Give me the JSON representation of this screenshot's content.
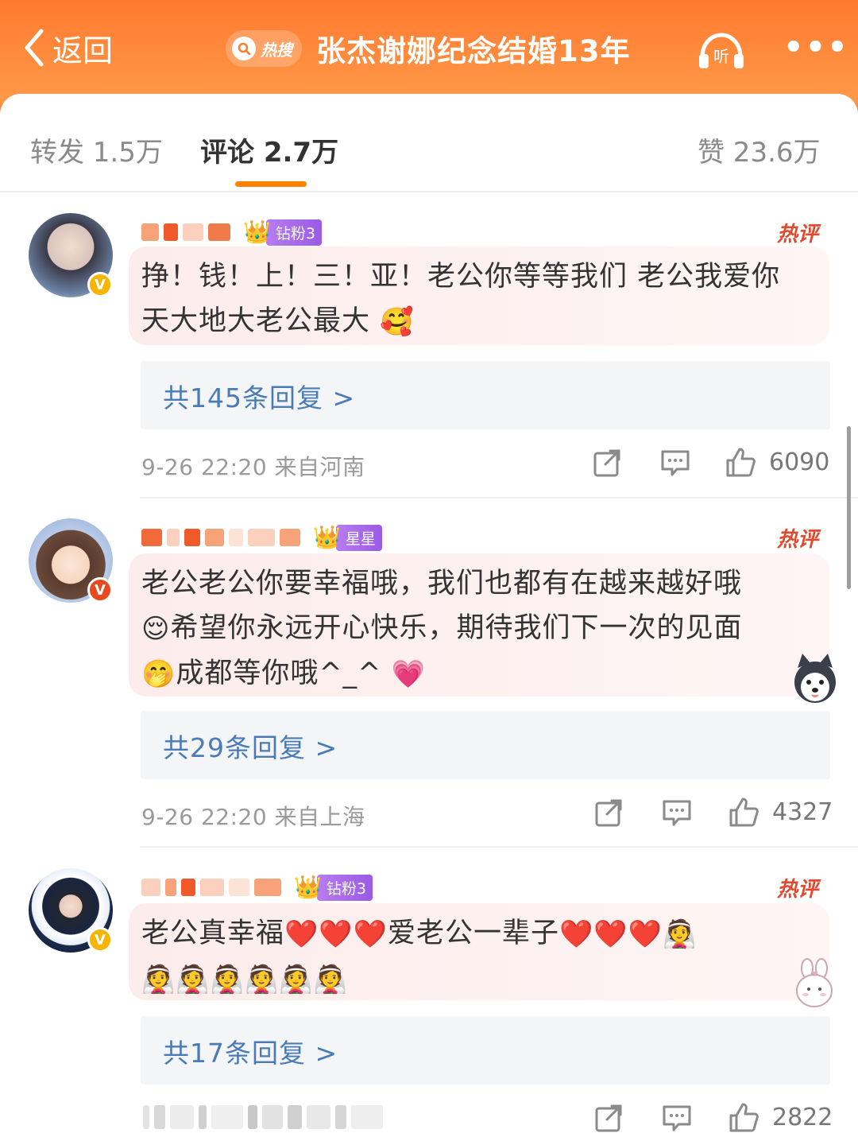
{
  "header": {
    "back_label": "返回",
    "hot_tag": "热搜",
    "title": "张杰谢娜纪念结婚13年",
    "listen_label": "听"
  },
  "tabs": {
    "repost": "转发 1.5万",
    "comment": "评论 2.7万",
    "like": "赞 23.6万"
  },
  "comments": [
    {
      "badge_label": "钻粉3",
      "hot_label": "热评",
      "text": "挣！钱！上！三！亚！老公你等等我们 老公我爱你 天大地大老公最大",
      "text_emoji": "🥰",
      "replies": "共145条回复 >",
      "meta": "9-26 22:20  来自河南",
      "likes": "6090",
      "verified": "V"
    },
    {
      "badge_label": "星星",
      "hot_label": "热评",
      "text_part1": "老公老公你要幸福哦，我们也都有在越来越好哦",
      "text_part2": "希望你永远开心快乐，期待我们下一次的见面",
      "text_part3": "成都等你哦^_^",
      "replies": "共29条回复 >",
      "meta": "9-26 22:20  来自上海",
      "likes": "4327",
      "verified": "V"
    },
    {
      "badge_label": "钻粉3",
      "hot_label": "热评",
      "text_part1": "老公真幸福",
      "text_part2": "爱老公一辈子",
      "replies": "共17条回复 >",
      "likes": "2822",
      "verified": "V"
    }
  ],
  "colors": {
    "header_orange": "#ff8a3d",
    "accent": "#ff8200",
    "link_blue": "#4a7bb5",
    "hot_red": "#e24a2f"
  }
}
